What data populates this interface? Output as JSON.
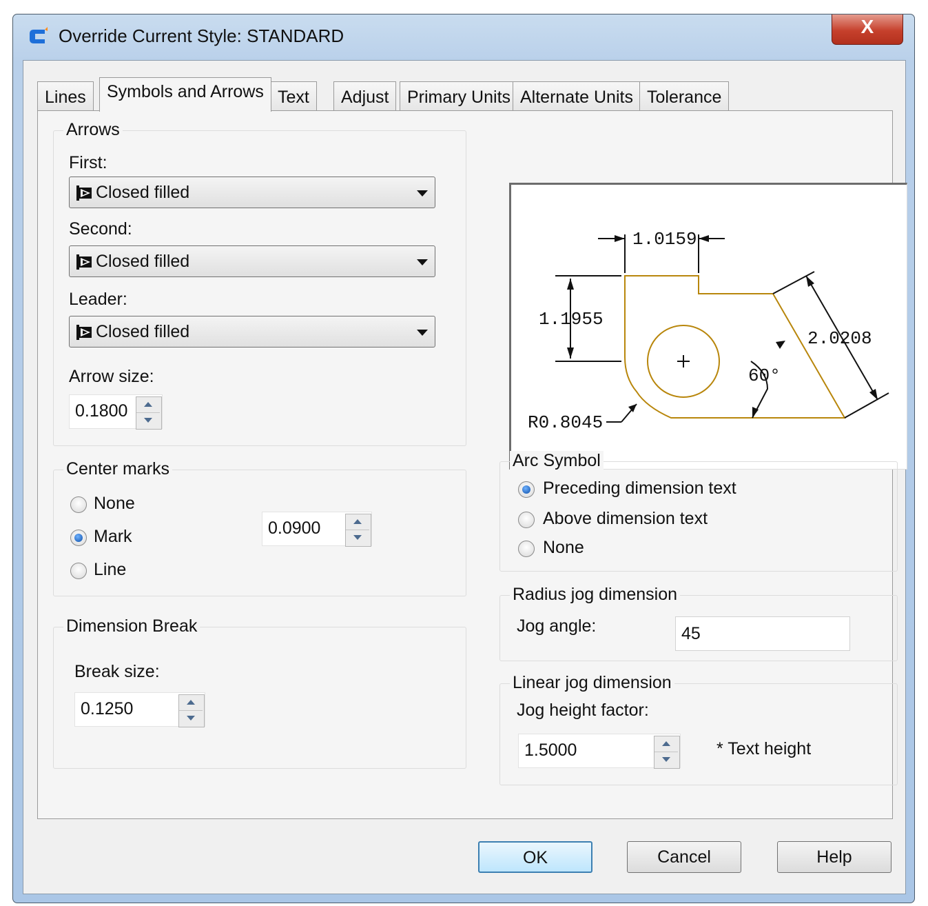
{
  "window": {
    "title": "Override Current Style: STANDARD",
    "close_label": "X"
  },
  "tabs": [
    {
      "label": "Lines",
      "active": false
    },
    {
      "label": "Symbols and Arrows",
      "active": true
    },
    {
      "label": "Text",
      "active": false
    },
    {
      "label": "Adjust",
      "active": false
    },
    {
      "label": "Primary Units",
      "active": false
    },
    {
      "label": "Alternate Units",
      "active": false
    },
    {
      "label": "Tolerance",
      "active": false
    }
  ],
  "arrows": {
    "title": "Arrows",
    "first_label": "First:",
    "first_value": "Closed filled",
    "second_label": "Second:",
    "second_value": "Closed filled",
    "leader_label": "Leader:",
    "leader_value": "Closed filled",
    "size_label": "Arrow size:",
    "size_value": "0.1800"
  },
  "center_marks": {
    "title": "Center marks",
    "options": [
      {
        "label": "None",
        "selected": false
      },
      {
        "label": "Mark",
        "selected": true
      },
      {
        "label": "Line",
        "selected": false
      }
    ],
    "size_value": "0.0900"
  },
  "dimension_break": {
    "title": "Dimension Break",
    "size_label": "Break size:",
    "size_value": "0.1250"
  },
  "preview": {
    "dim_top": "1.0159",
    "dim_left": "1.1955",
    "dim_slant": "2.0208",
    "angle": "60°",
    "radius": "R0.8045",
    "outline_color": "#b8860b"
  },
  "arc_symbol": {
    "title": "Arc Symbol",
    "options": [
      {
        "label": "Preceding dimension text",
        "selected": true
      },
      {
        "label": "Above dimension text",
        "selected": false
      },
      {
        "label": "None",
        "selected": false
      }
    ]
  },
  "radius_jog": {
    "title": "Radius jog dimension",
    "angle_label": "Jog angle:",
    "angle_value": "45"
  },
  "linear_jog": {
    "title": "Linear jog dimension",
    "factor_label": "Jog height factor:",
    "factor_value": "1.5000",
    "note": "* Text height"
  },
  "buttons": {
    "ok": "OK",
    "cancel": "Cancel",
    "help": "Help"
  },
  "colors": {
    "title_bar": "#b9d0ea",
    "close_button": "#c6402c",
    "dialog_bg": "#f0f0f0",
    "radio_selected": "#0e4fa8"
  }
}
